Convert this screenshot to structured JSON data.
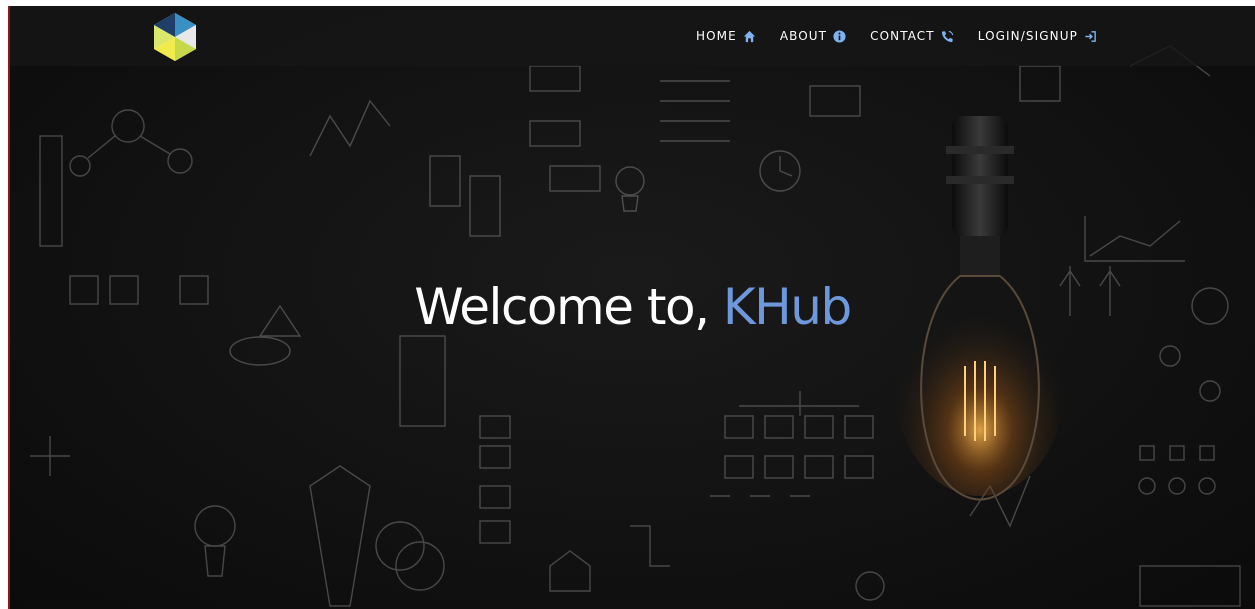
{
  "nav": {
    "logo_icon": "hexagon-logo",
    "items": [
      {
        "label": "HOME",
        "icon": "home-icon"
      },
      {
        "label": "ABOUT",
        "icon": "info-icon"
      },
      {
        "label": "CONTACT",
        "icon": "phone-icon"
      },
      {
        "label": "LOGIN/SIGNUP",
        "icon": "sign-in-icon"
      }
    ]
  },
  "hero": {
    "greeting": "Welcome to,",
    "brand": "KHub"
  },
  "colors": {
    "brand_accent": "#6e98dc",
    "nav_text": "#ffffff",
    "hero_background": "#121212",
    "left_edge": "#8a1820"
  }
}
